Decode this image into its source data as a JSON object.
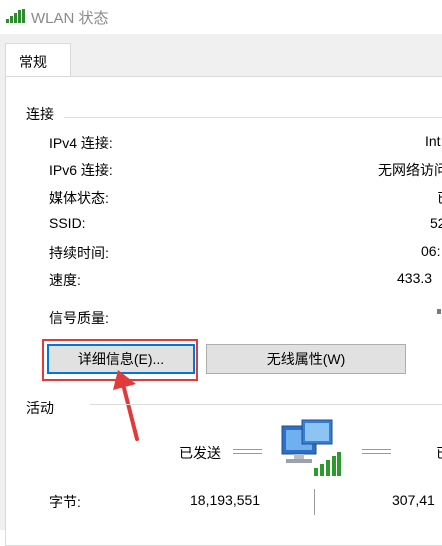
{
  "window": {
    "title": "WLAN 状态",
    "icon": "wifi-signal-icon"
  },
  "tabs": [
    {
      "label": "常规"
    }
  ],
  "connection": {
    "group_label": "连接",
    "rows": [
      {
        "label": "IPv4 连接:",
        "value": "Int"
      },
      {
        "label": "IPv6 连接:",
        "value": "无网络访问"
      },
      {
        "label": "媒体状态:",
        "value": "已"
      },
      {
        "label": "SSID:",
        "value": "52"
      },
      {
        "label": "持续时间:",
        "value": "06:"
      },
      {
        "label": "速度:",
        "value": "433.3"
      }
    ],
    "signal_label": "信号质量:"
  },
  "buttons": {
    "details": "详细信息(E)...",
    "wireless": "无线属性(W)"
  },
  "activity": {
    "group_label": "活动",
    "sent_label": "已发送",
    "received_label": "已",
    "bytes_label": "字节:",
    "bytes_sent": "18,193,551",
    "bytes_received": "307,41"
  },
  "colors": {
    "highlight": "#e03a3a",
    "accent": "#0078d7"
  }
}
